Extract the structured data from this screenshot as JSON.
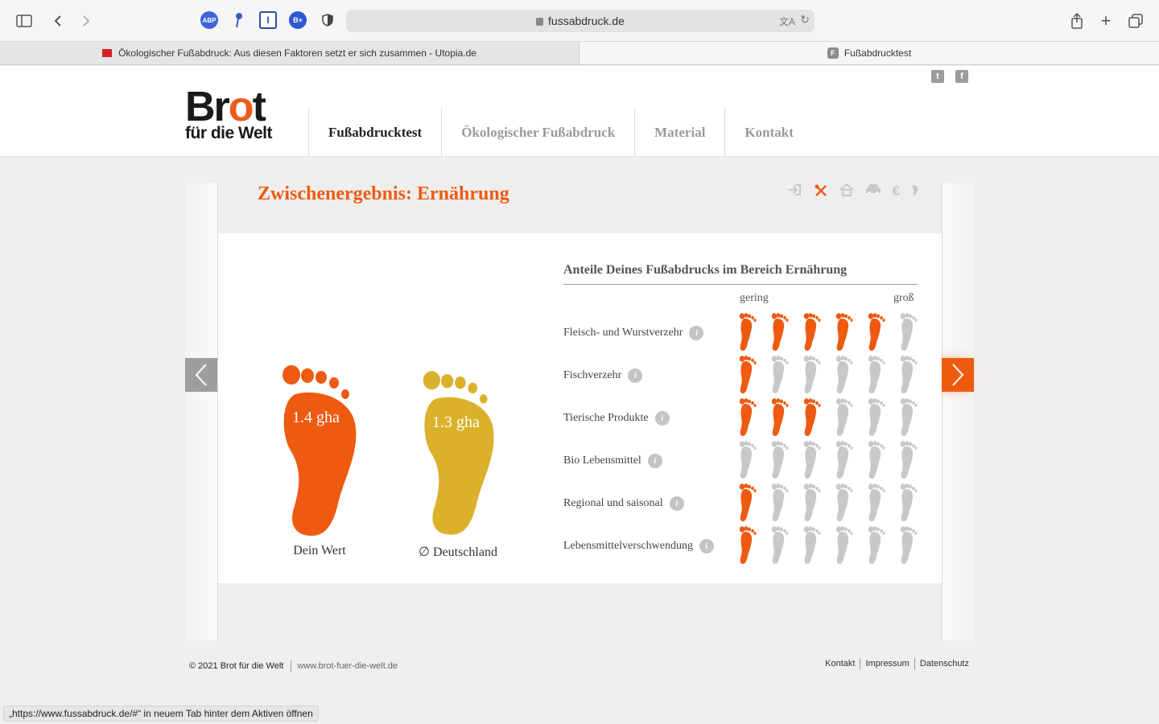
{
  "browser": {
    "url": "fussabdruck.de",
    "tabs": [
      {
        "title": "Ökologischer Fußabdruck: Aus diesen Faktoren setzt er sich zusammen - Utopia.de"
      },
      {
        "title": "Fußabdrucktest"
      }
    ],
    "extensions": [
      "ABP",
      "B+"
    ],
    "status_text": "„https://www.fussabdruck.de/#“ in neuem Tab hinter dem Aktiven öffnen"
  },
  "site": {
    "logo_top": "Br",
    "logo_o": "o",
    "logo_t": "t",
    "logo_bottom": "für die Welt",
    "nav": [
      {
        "label": "Fußabdrucktest",
        "active": true
      },
      {
        "label": "Ökologischer Fußabdruck",
        "active": false
      },
      {
        "label": "Material",
        "active": false
      },
      {
        "label": "Kontakt",
        "active": false
      }
    ]
  },
  "result": {
    "title": "Zwischenergebnis: Ernährung",
    "categories": [
      "login-icon",
      "food-icon",
      "home-icon",
      "car-icon",
      "euro-icon",
      "foot-icon"
    ],
    "active_category": 1,
    "your_value": "1.4 gha",
    "your_label": "Dein Wert",
    "avg_value": "1.3 gha",
    "avg_label": "∅ Deutschland",
    "colors": {
      "orange": "#ee5a12",
      "gold": "#dbb12c",
      "grey": "#c8c8c8"
    }
  },
  "breakdown": {
    "title": "Anteile Deines Fußabdrucks im Bereich Ernährung",
    "scale_low": "gering",
    "scale_high": "groß",
    "info_symbol": "i",
    "rows": [
      {
        "label": "Fleisch- und Wurstverzehr",
        "level": 5
      },
      {
        "label": "Fischverzehr",
        "level": 1
      },
      {
        "label": "Tierische Produkte",
        "level": 3
      },
      {
        "label": "Bio Lebensmittel",
        "level": 0
      },
      {
        "label": "Regional und saisonal",
        "level": 1
      },
      {
        "label": "Lebensmittelverschwendung",
        "level": 1
      }
    ],
    "max_level": 6
  },
  "footer": {
    "copyright": "© 2021 Brot für die Welt",
    "site_url": "www.brot-fuer-die-welt.de",
    "links": [
      "Kontakt",
      "Impressum",
      "Datenschutz"
    ]
  }
}
